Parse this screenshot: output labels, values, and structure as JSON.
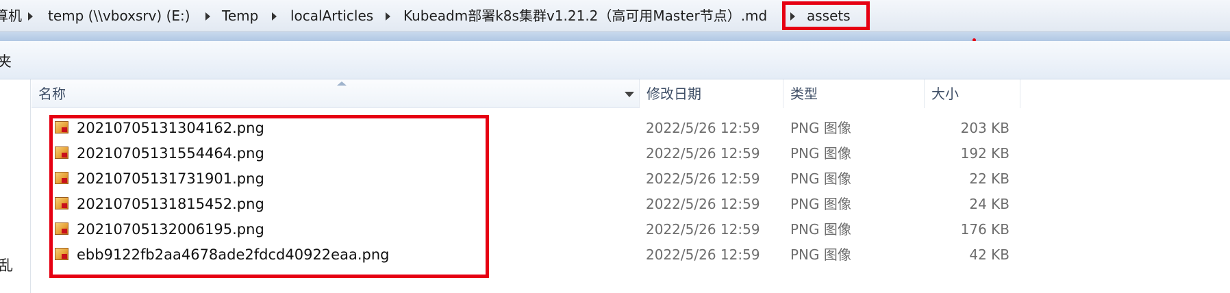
{
  "address_bar": {
    "crumbs": [
      "算机",
      "temp (\\\\vboxsrv) (E:)",
      "Temp",
      "localArticles",
      "Kubeadm部署k8s集群v1.21.2（高可用Master节点）.md",
      "assets"
    ]
  },
  "toolbar": {
    "fragment": "夹"
  },
  "nav": {
    "fragment": "乱"
  },
  "columns": {
    "name": "名称",
    "date": "修改日期",
    "type": "类型",
    "size": "大小"
  },
  "files": [
    {
      "name": "20210705131304162.png",
      "date": "2022/5/26 12:59",
      "type": "PNG 图像",
      "size": "203 KB"
    },
    {
      "name": "20210705131554464.png",
      "date": "2022/5/26 12:59",
      "type": "PNG 图像",
      "size": "192 KB"
    },
    {
      "name": "20210705131731901.png",
      "date": "2022/5/26 12:59",
      "type": "PNG 图像",
      "size": "22 KB"
    },
    {
      "name": "20210705131815452.png",
      "date": "2022/5/26 12:59",
      "type": "PNG 图像",
      "size": "24 KB"
    },
    {
      "name": "20210705132006195.png",
      "date": "2022/5/26 12:59",
      "type": "PNG 图像",
      "size": "176 KB"
    },
    {
      "name": "ebb9122fb2aa4678ade2fdcd40922eaa.png",
      "date": "2022/5/26 12:59",
      "type": "PNG 图像",
      "size": "42 KB"
    }
  ],
  "colors": {
    "highlight": "#e60012",
    "header_text": "#3e4e66",
    "detail_text": "#6d6d6d"
  },
  "icons": {
    "breadcrumb_separator": "triangle-right",
    "file": "png-image-icon"
  }
}
